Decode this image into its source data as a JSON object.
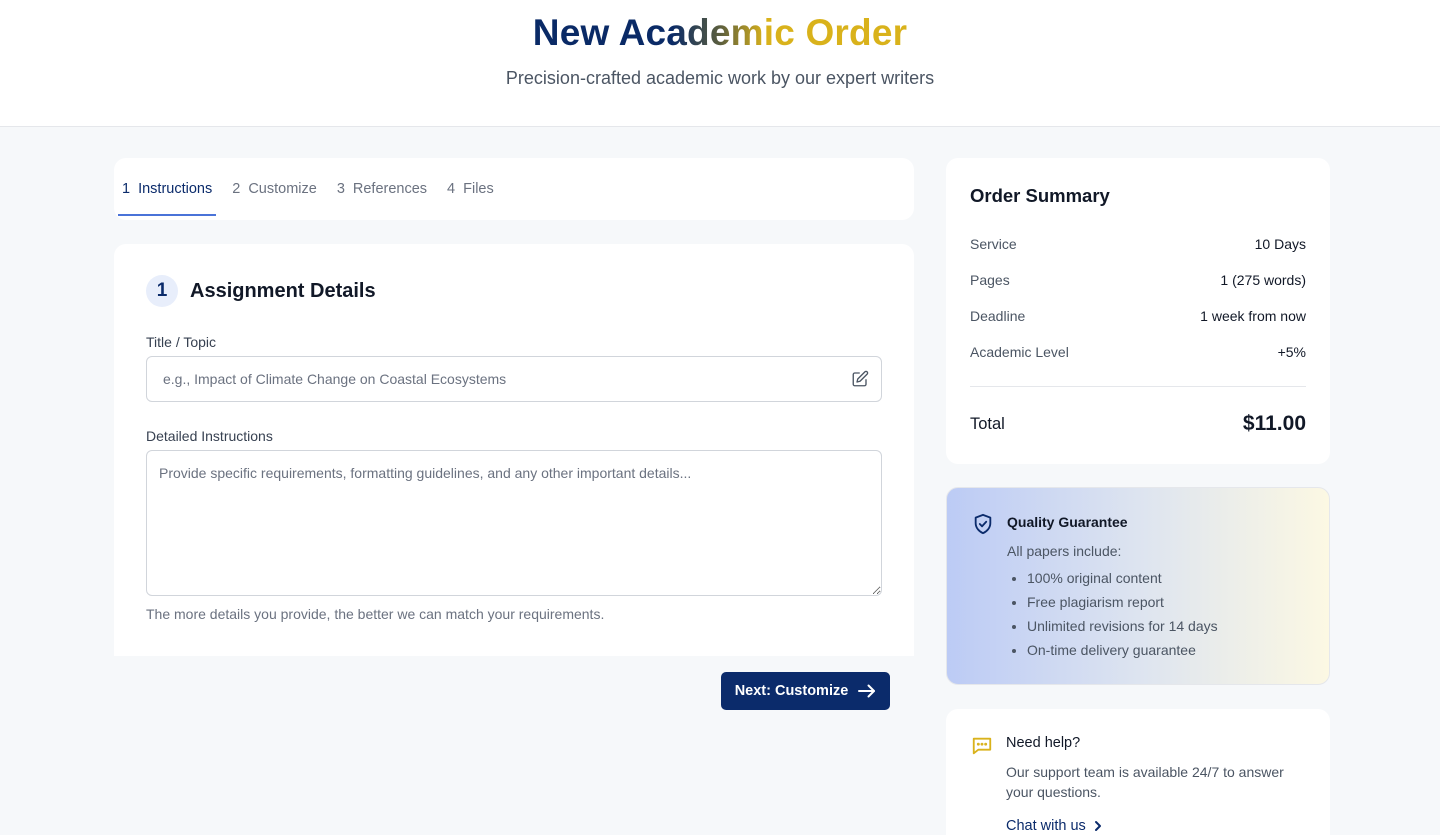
{
  "header": {
    "title": "New Academic Order",
    "subtitle": "Precision-crafted academic work by our expert writers"
  },
  "tabs": [
    {
      "num": "1",
      "label": "Instructions",
      "active": true
    },
    {
      "num": "2",
      "label": "Customize",
      "active": false
    },
    {
      "num": "3",
      "label": "References",
      "active": false
    },
    {
      "num": "4",
      "label": "Files",
      "active": false
    }
  ],
  "form": {
    "step": "1",
    "section_title": "Assignment Details",
    "title_label": "Title / Topic",
    "title_placeholder": "e.g., Impact of Climate Change on Coastal Ecosystems",
    "title_value": "",
    "instructions_label": "Detailed Instructions",
    "instructions_placeholder": "Provide specific requirements, formatting guidelines, and any other important details...",
    "instructions_value": "",
    "help_text": "The more details you provide, the better we can match your requirements.",
    "next_label": "Next: Customize"
  },
  "summary": {
    "title": "Order Summary",
    "rows": [
      {
        "key": "Service",
        "value": "10 Days"
      },
      {
        "key": "Pages",
        "value": "1 (275 words)"
      },
      {
        "key": "Deadline",
        "value": "1 week from now"
      },
      {
        "key": "Academic Level",
        "value": "+5%"
      }
    ],
    "total_label": "Total",
    "total_value": "$11.00"
  },
  "guarantee": {
    "title": "Quality Guarantee",
    "subtitle": "All papers include:",
    "items": [
      "100% original content",
      "Free plagiarism report",
      "Unlimited revisions for 14 days",
      "On-time delivery guarantee"
    ],
    "icon": "shield-check-icon"
  },
  "help": {
    "title": "Need help?",
    "text": "Our support team is available 24/7 to answer your questions.",
    "link": "Chat with us",
    "icon": "chat-bubble-icon"
  },
  "colors": {
    "primary": "#0b2b6b",
    "accent_gold": "#d9b21b",
    "tab_underline": "#4a73d8"
  }
}
